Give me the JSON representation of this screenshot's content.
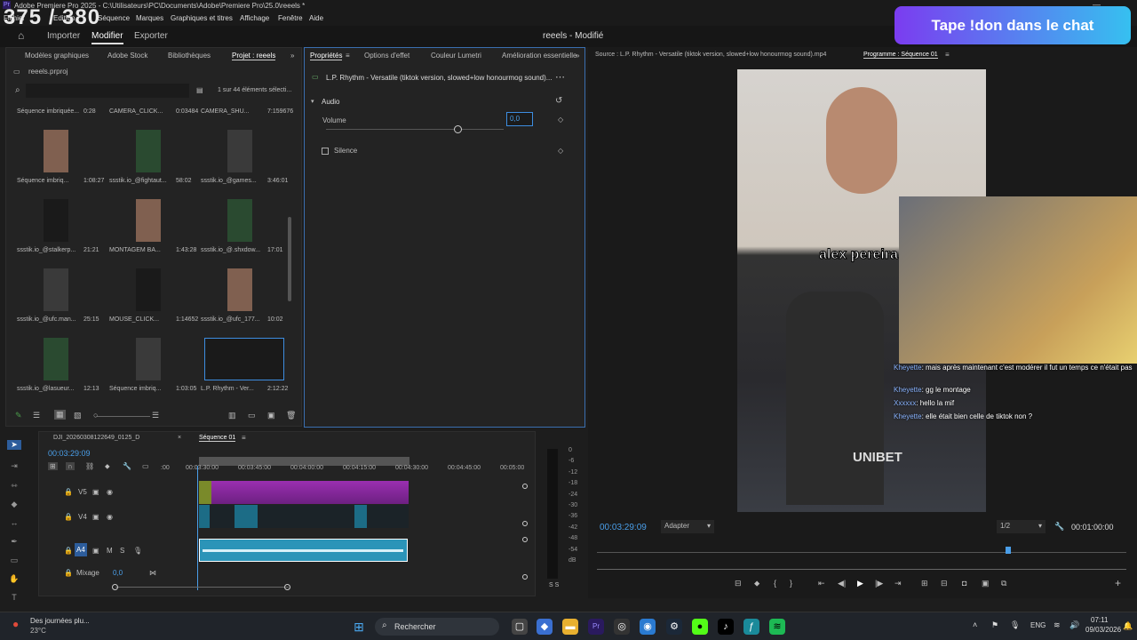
{
  "window": {
    "title": "Adobe Premiere Pro 2025 - C:\\Utilisateurs\\PC\\Documents\\Adobe\\Premiere Pro\\25.0\\reeels *",
    "overlay_counter": "375 / 380"
  },
  "menu": [
    "Fichier",
    "Edition",
    "Séquence",
    "Marques",
    "Graphiques et titres",
    "Affichage",
    "Fenêtre",
    "Aide"
  ],
  "header": {
    "tabs": [
      "Importer",
      "Modifier",
      "Exporter"
    ],
    "active": "Modifier",
    "project_title": "reeels - Modifié"
  },
  "donation_banner": "Tape !don dans le chat",
  "left_tabs": [
    "Modèles graphiques",
    "Adobe Stock",
    "Bibliothèques",
    "Projet : reeels"
  ],
  "project": {
    "file": "reeels.prproj",
    "count": "1 sur 44 éléments sélecti...",
    "items": [
      {
        "name": "Séquence imbriquée...",
        "dur": "0:28"
      },
      {
        "name": "CAMERA_CLICK...",
        "dur": "0:03484"
      },
      {
        "name": "CAMERA_SHU...",
        "dur": "7:159676"
      },
      {
        "name": "Séquence imbriq...",
        "dur": "1:08:27"
      },
      {
        "name": "ssstik.io_@fightaut...",
        "dur": "58:02"
      },
      {
        "name": "ssstik.io_@games...",
        "dur": "3:46:01"
      },
      {
        "name": "ssstik.io_@stalkerp...",
        "dur": "21:21"
      },
      {
        "name": "MONTAGEM BA...",
        "dur": "1:43:28"
      },
      {
        "name": "ssstik.io_@.shxdow...",
        "dur": "17:01"
      },
      {
        "name": "ssstik.io_@ufc.man...",
        "dur": "25:15"
      },
      {
        "name": "MOUSE_CLICK...",
        "dur": "1:14652"
      },
      {
        "name": "ssstik.io_@ufc_177...",
        "dur": "10:02"
      },
      {
        "name": "ssstik.io_@lasueur...",
        "dur": "12:13"
      },
      {
        "name": "Séquence imbriq...",
        "dur": "1:03:05"
      },
      {
        "name": "L.P. Rhythm - Ver...",
        "dur": "2:12:22"
      }
    ]
  },
  "props": {
    "tabs": [
      "Propriétés",
      "Options d'effet",
      "Couleur Lumetri",
      "Amélioration essentielle"
    ],
    "clip": "L.P. Rhythm - Versatile (tiktok version, slowed+low honourmog sound)...",
    "section": "Audio",
    "volume_label": "Volume",
    "volume_value": "0,0",
    "silence_label": "Silence"
  },
  "monitor": {
    "source_tab": "Source : L.P. Rhythm - Versatile (tiktok version, slowed+low honourmog sound).mp4",
    "program_tab": "Programme : Séquence 01",
    "timecode": "00:03:29:09",
    "fit": "Adapter",
    "res": "1/2",
    "duration": "00:01:00:00",
    "caption": "alex pereira"
  },
  "chat": [
    {
      "user": "Kheyette",
      "msg": "mais après maintenant c'est modérer il fut un temps ce n'était pas"
    },
    {
      "user": "Kheyette",
      "msg": "gg le montage"
    },
    {
      "user": "Xxxxxx",
      "msg": "hello la mif"
    },
    {
      "user": "Kheyette",
      "msg": "elle était bien celle de tiktok non ?"
    }
  ],
  "timeline": {
    "tabs": [
      "DJI_20260308122649_0125_D",
      "Séquence 01"
    ],
    "timecode": "00:03:29:09",
    "ruler": [
      "00:03:30:00",
      "00:03:45:00",
      "00:04:00:00",
      "00:04:15:00",
      "00:04:30:00",
      "00:04:45:00",
      "00:05:00"
    ],
    "tracks": [
      "V5",
      "V4",
      "A4",
      "Mixage"
    ],
    "mix_value": "0,0"
  },
  "meter": {
    "labels": [
      "0",
      "-6",
      "-12",
      "-18",
      "-24",
      "-30",
      "-36",
      "-42",
      "-48",
      "-54",
      "dB"
    ]
  },
  "taskbar": {
    "weather_text": "Des journées plu...",
    "temp": "23°C",
    "search": "Rechercher",
    "lang": "ENG",
    "time": "07:11",
    "date": "09/03/2026"
  }
}
